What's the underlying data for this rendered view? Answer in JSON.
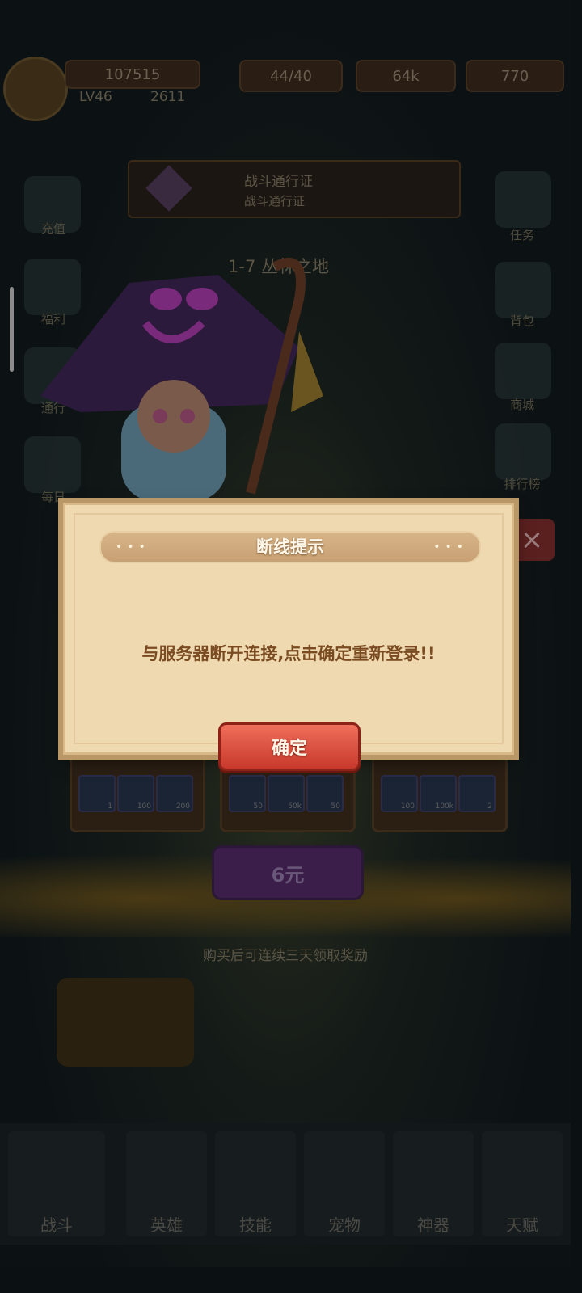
{
  "hud": {
    "power": "107515",
    "level": "LV46",
    "swords": "2611",
    "stamina": "44/40",
    "gold": "64k",
    "gems": "770"
  },
  "banner": {
    "line1": "战斗通行证",
    "line2": "战斗通行证"
  },
  "stage": "1-7 丛林之地",
  "side_left": [
    {
      "label": "充值"
    },
    {
      "label": "福利"
    },
    {
      "label": "通行"
    },
    {
      "label": "每日"
    }
  ],
  "side_right": [
    {
      "label": "任务"
    },
    {
      "label": "背包"
    },
    {
      "label": "商城"
    },
    {
      "label": "排行榜"
    }
  ],
  "rewards": [
    {
      "items": [
        "1",
        "100",
        "200"
      ]
    },
    {
      "items": [
        "50",
        "50k",
        "50"
      ]
    },
    {
      "items": [
        "100",
        "100k",
        "2"
      ]
    }
  ],
  "price_label": "6元",
  "hint": "购买后可连续三天领取奖励",
  "tabs": [
    {
      "label": "战斗"
    },
    {
      "label": "英雄"
    },
    {
      "label": "技能"
    },
    {
      "label": "宠物"
    },
    {
      "label": "神器"
    },
    {
      "label": "天赋"
    }
  ],
  "dialog": {
    "title": "断线提示",
    "message": "与服务器断开连接,点击确定重新登录!!",
    "confirm_label": "确定"
  },
  "colors": {
    "dialog_bg": "#efd9b0",
    "confirm_button": "#d9473a",
    "message_text": "#7a4a21"
  }
}
